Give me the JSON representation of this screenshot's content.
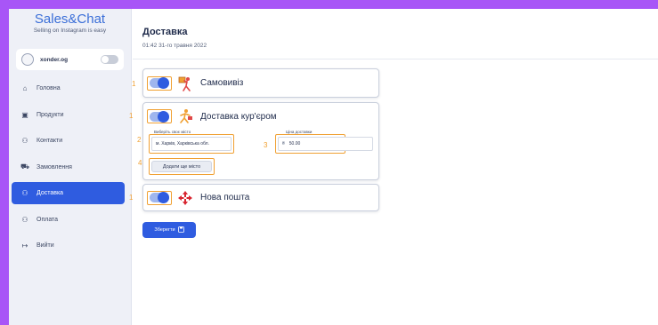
{
  "brand": {
    "title": "Sales&Chat",
    "subtitle": "Selling on Instagram is easy"
  },
  "user": {
    "name": "xonder.og"
  },
  "nav": [
    {
      "label": "Головна",
      "icon": "home-icon"
    },
    {
      "label": "Продукти",
      "icon": "box-icon"
    },
    {
      "label": "Контакти",
      "icon": "contacts-icon"
    },
    {
      "label": "Замовлення",
      "icon": "cart-icon"
    },
    {
      "label": "Доставка",
      "icon": "delivery-icon",
      "active": true
    },
    {
      "label": "Оплата",
      "icon": "payment-icon"
    },
    {
      "label": "Вийти",
      "icon": "logout-icon"
    }
  ],
  "page": {
    "title": "Доставка",
    "timestamp": "01:42 31-го травня 2022"
  },
  "methods": {
    "pickup": {
      "label": "Самовивіз",
      "enabled": true,
      "icon": "person-carrying-box-icon"
    },
    "courier": {
      "label": "Доставка кур'єром",
      "enabled": true,
      "icon": "courier-runner-icon",
      "city_label": "Виберіть своє місто",
      "city_value": "м. Харків, Харківська обл.",
      "price_label": "Ціна доставки",
      "price_currency": "₴",
      "price_value": "50.00",
      "add_city_label": "Додати ще місто"
    },
    "nova_poshta": {
      "label": "Нова пошта",
      "enabled": true,
      "icon": "nova-poshta-logo-icon"
    }
  },
  "annotations": [
    "1",
    "1",
    "2",
    "3",
    "4",
    "1"
  ],
  "save_button": {
    "label": "Зберегти"
  },
  "colors": {
    "accent": "#2f5ce0",
    "highlight": "#f0a032",
    "background": "#a855f7"
  }
}
